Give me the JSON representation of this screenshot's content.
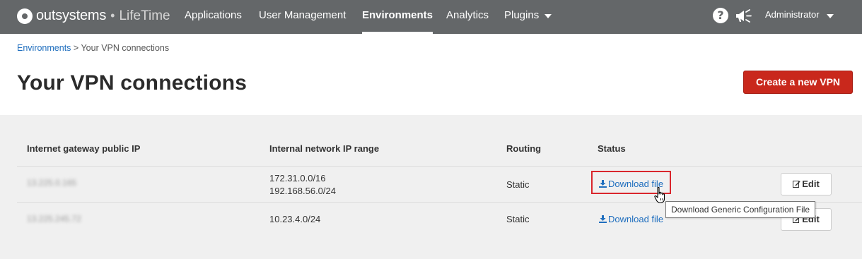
{
  "brand": {
    "name": "outsystems",
    "separator": "•",
    "product": "LifeTime"
  },
  "nav": {
    "items": [
      {
        "label": "Applications",
        "active": false
      },
      {
        "label": "User Management",
        "active": false
      },
      {
        "label": "Environments",
        "active": true
      },
      {
        "label": "Analytics",
        "active": false
      },
      {
        "label": "Plugins",
        "active": false,
        "has_dropdown": true
      }
    ],
    "help_icon": "?",
    "user": "Administrator"
  },
  "breadcrumb": {
    "parent": "Environments",
    "separator": ">",
    "current": "Your VPN connections"
  },
  "page": {
    "title": "Your VPN connections",
    "create_button": "Create a new VPN"
  },
  "table": {
    "headers": [
      "Internet gateway public IP",
      "Internal network IP range",
      "Routing",
      "Status"
    ],
    "rows": [
      {
        "gateway_ip": "13.225.0.165",
        "ip_ranges": [
          "172.31.0.0/16",
          "192.168.56.0/24"
        ],
        "routing": "Static",
        "status_link": "Download file",
        "edit_label": "Edit"
      },
      {
        "gateway_ip": "13.225.245.72",
        "ip_ranges": [
          "10.23.4.0/24"
        ],
        "routing": "Static",
        "status_link": "Download file",
        "edit_label": "Edit"
      }
    ]
  },
  "tooltip": "Download Generic Configuration File",
  "colors": {
    "navbar": "#646769",
    "accent_red": "#c9281c",
    "link_blue": "#1f6ebe",
    "highlight": "#d9262c"
  }
}
